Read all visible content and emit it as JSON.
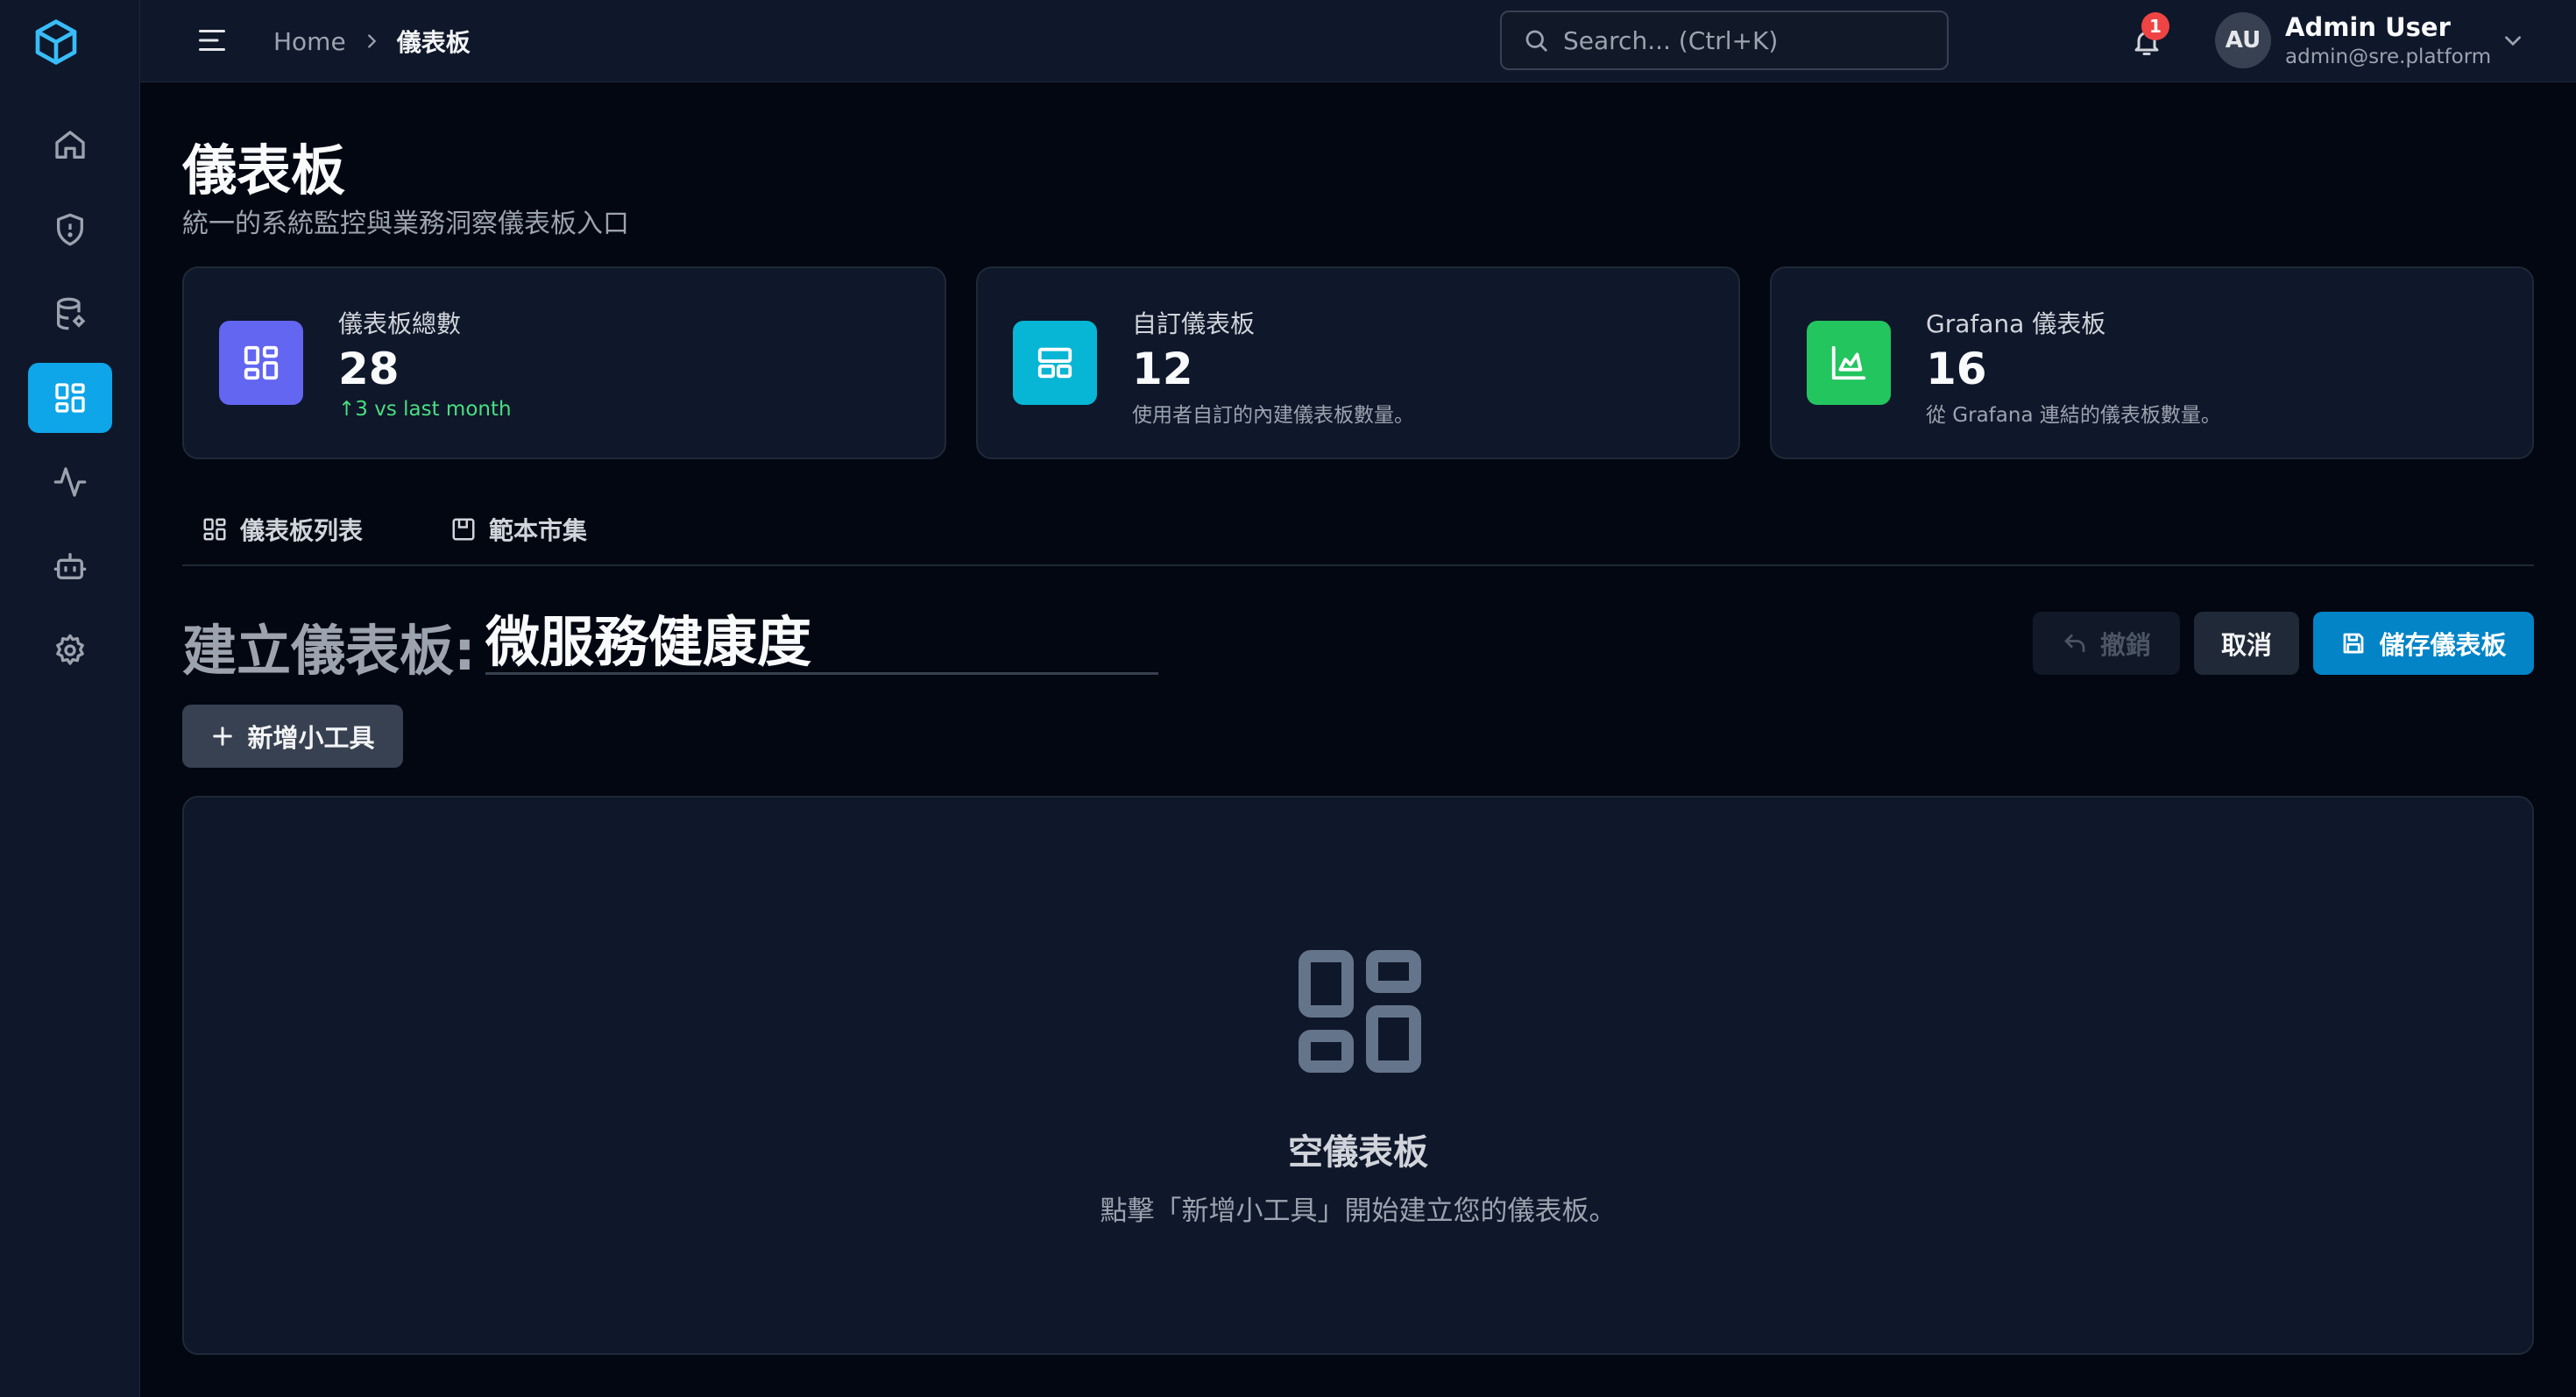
{
  "sidebar": {
    "logo_icon": "cube-icon",
    "items": [
      {
        "name": "home",
        "icon": "home-icon"
      },
      {
        "name": "security",
        "icon": "shield-icon"
      },
      {
        "name": "resources",
        "icon": "database-icon"
      },
      {
        "name": "dashboards",
        "icon": "dashboard-grid-icon",
        "active": true
      },
      {
        "name": "monitoring",
        "icon": "activity-icon"
      },
      {
        "name": "automation",
        "icon": "robot-icon"
      },
      {
        "name": "settings",
        "icon": "gear-icon"
      }
    ],
    "active_color": "#0ea5e9"
  },
  "topbar": {
    "breadcrumb": {
      "home": "Home",
      "separator": ">",
      "current": "儀表板"
    },
    "search_placeholder": "Search... (Ctrl+K)",
    "notifications_count": "1",
    "user": {
      "initials": "AU",
      "name": "Admin User",
      "email": "admin@sre.platform"
    }
  },
  "page": {
    "title": "儀表板",
    "subtitle": "統一的系統監控與業務洞察儀表板入口"
  },
  "stats": [
    {
      "label": "儀表板總數",
      "value": "28",
      "note": "↑3 vs last month",
      "icon": "dashboard-grid-icon",
      "color": "#6366f1"
    },
    {
      "label": "自訂儀表板",
      "value": "12",
      "note": "使用者自訂的內建儀表板數量。",
      "icon": "layout-icon",
      "color": "#06b6d4"
    },
    {
      "label": "Grafana 儀表板",
      "value": "16",
      "note": "從 Grafana 連結的儀表板數量。",
      "icon": "area-chart-icon",
      "color": "#22c55e"
    }
  ],
  "tabs": [
    {
      "label": "儀表板列表",
      "icon": "dashboard-grid-icon"
    },
    {
      "label": "範本市集",
      "icon": "template-icon"
    }
  ],
  "builder": {
    "prefix": "建立儀表板:",
    "title_value": "微服務健康度",
    "undo_label": "撤銷",
    "cancel_label": "取消",
    "save_label": "儲存儀表板",
    "add_widget_label": "新增小工具"
  },
  "empty_state": {
    "icon": "dashboard-grid-icon",
    "title": "空儀表板",
    "description": "點擊「新增小工具」開始建立您的儀表板。"
  }
}
